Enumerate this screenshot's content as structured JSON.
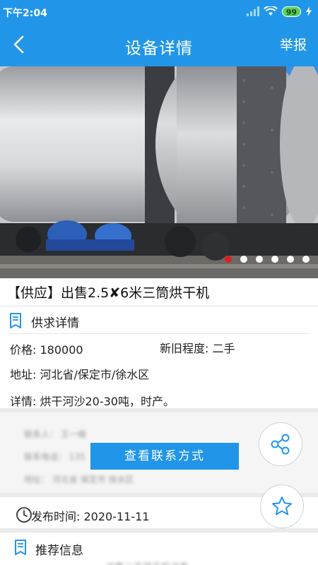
{
  "status_bar": {
    "time": "下午2:04",
    "battery": "99"
  },
  "nav": {
    "title": "设备详情",
    "report": "举报"
  },
  "hero": {
    "page_count": 6,
    "active_index": 0
  },
  "listing": {
    "title_prefix": "【供应】",
    "title_text": "出售2.5✘6米三筒烘干机"
  },
  "details": {
    "heading": "供求详情",
    "price": "价格: 180000",
    "condition": "新旧程度: 二手",
    "address": "地址: 河北省/保定市/徐水区",
    "description": "详情: 烘干河沙20-30吨，时产。"
  },
  "contact": {
    "blurred_lines": [
      "联系人：  王一峰",
      "联系电话：  135",
      "地址：  河北省 保定市 徐水区"
    ],
    "view_button": "查看联系方式"
  },
  "publish": {
    "label": "发布时间: 2020-11-11"
  },
  "recommend": {
    "heading": "推荐信息",
    "blurred_teaser": "出售二手烘干机设备"
  },
  "icons": {
    "back": "chevron-left-icon",
    "share": "share-icon",
    "favorite": "star-icon",
    "clock": "clock-icon",
    "section": "document-icon"
  },
  "colors": {
    "primary": "#2196e8",
    "pager_active": "#e02020"
  }
}
